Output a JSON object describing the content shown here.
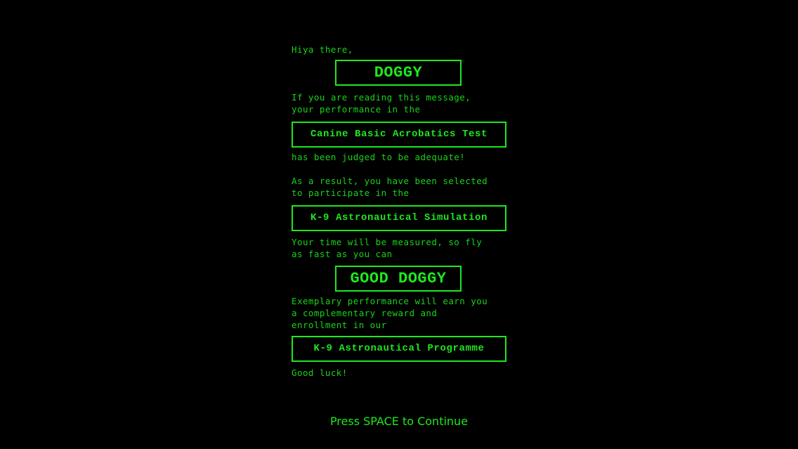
{
  "message": {
    "greeting": "Hiya there,",
    "name_box": "DOGGY",
    "para1_line1": "If you are reading this message,",
    "para1_line2": "your performance in the",
    "test_box": "Canine Basic Acrobatics Test",
    "para2_line1": "has been judged to be adequate!",
    "para3_line1": "As a result, you have been selected",
    "para3_line2": "to participate in the",
    "simulation_box": "K-9 Astronautical Simulation",
    "para4_line1": "Your time will be measured, so fly",
    "para4_line2": "as fast as you can",
    "praise_box": "GOOD DOGGY",
    "para5_line1": "Exemplary performance will earn you",
    "para5_line2": "a complementary reward and",
    "para5_line3": "enrollment in our",
    "programme_box": "K-9 Astronautical Programme",
    "closing": "Good luck!"
  },
  "footer": {
    "continue_prompt": "Press SPACE to Continue"
  },
  "colors": {
    "background": "#000000",
    "text": "#19d319",
    "accent": "#1ee81e"
  }
}
